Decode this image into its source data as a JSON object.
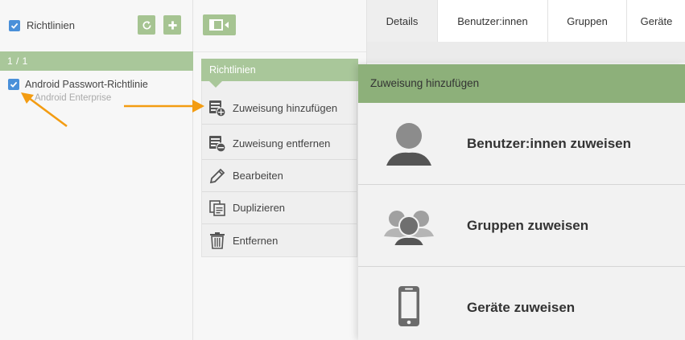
{
  "left_panel": {
    "title": "Richtlinien",
    "counter": "1 / 1",
    "tool_icons": [
      "refresh-icon",
      "plus-icon"
    ],
    "item": {
      "title": "Android Passwort-Richtlinie",
      "subtitle": "Android Enterprise"
    }
  },
  "middle_panel": {
    "toggle_icon": "collapse-panel-icon",
    "menu_header": "Richtlinien",
    "menu_items": [
      {
        "label": "Zuweisung hinzufügen",
        "icon": "assign-add-icon"
      },
      {
        "label": "Zuweisung entfernen",
        "icon": "assign-remove-icon"
      },
      {
        "label": "Bearbeiten",
        "icon": "pencil-icon"
      },
      {
        "label": "Duplizieren",
        "icon": "duplicate-icon"
      },
      {
        "label": "Entfernen",
        "icon": "trash-icon"
      }
    ]
  },
  "tabs": [
    "Details",
    "Benutzer:innen",
    "Gruppen",
    "Geräte"
  ],
  "modal": {
    "title": "Zuweisung hinzufügen",
    "options": [
      {
        "label": "Benutzer:innen zuweisen",
        "icon": "user-icon"
      },
      {
        "label": "Gruppen zuweisen",
        "icon": "group-icon"
      },
      {
        "label": "Geräte zuweisen",
        "icon": "phone-icon"
      }
    ]
  },
  "colors": {
    "accent_green": "#a9c79a",
    "modal_header": "#8db07a",
    "checkbox_blue": "#4a90d9",
    "arrow_orange": "#f39c12"
  }
}
